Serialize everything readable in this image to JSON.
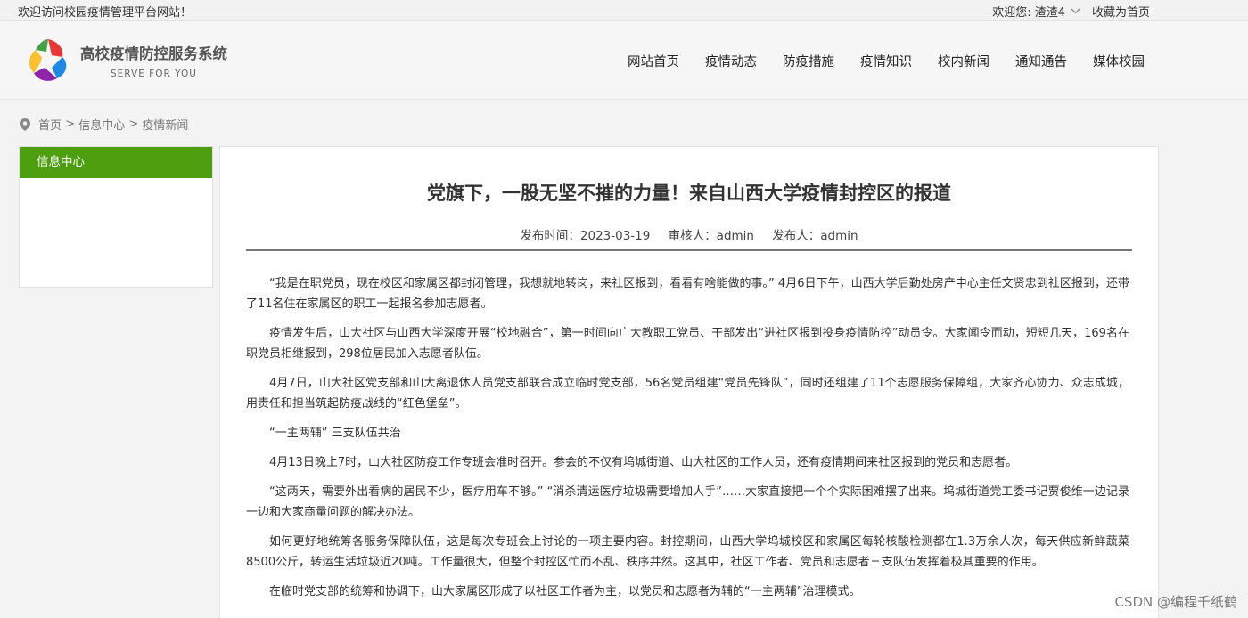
{
  "topbar": {
    "welcome": "欢迎访问校园疫情管理平台网站！",
    "user": "欢迎您: 渣渣4",
    "favorite": "收藏为首页"
  },
  "header": {
    "title": "高校疫情防控服务系统",
    "subtitle": "SERVE FOR YOU",
    "nav": [
      "网站首页",
      "疫情动态",
      "防疫措施",
      "疫情知识",
      "校内新闻",
      "通知通告",
      "媒体校园"
    ]
  },
  "breadcrumb": {
    "home": "首页",
    "sep": " > ",
    "section": "信息中心",
    "page": "疫情新闻"
  },
  "sidebar": {
    "heading": "信息中心"
  },
  "article": {
    "title": "党旗下，一股无坚不摧的力量！来自山西大学疫情封控区的报道",
    "publish_time": "发布时间：2023-03-19",
    "reviewer": "审核人：admin",
    "publisher": "发布人：admin",
    "paragraphs": [
      "“我是在职党员，现在校区和家属区都封闭管理，我想就地转岗，来社区报到，看看有啥能做的事。”  4月6日下午，山西大学后勤处房产中心主任文贤忠到社区报到，还带了11名住在家属区的职工一起报名参加志愿者。",
      "疫情发生后，山大社区与山西大学深度开展“校地融合”，第一时间向广大教职工党员、干部发出“进社区报到投身疫情防控”动员令。大家闻令而动，短短几天，169名在职党员相继报到，298位居民加入志愿者队伍。",
      "4月7日，山大社区党支部和山大离退休人员党支部联合成立临时党支部，56名党员组建“党员先锋队”，同时还组建了11个志愿服务保障组，大家齐心协力、众志成城，用责任和担当筑起防疫战线的“红色堡垒”。",
      "“一主两辅” 三支队伍共治",
      "4月13日晚上7时，山大社区防疫工作专班会准时召开。参会的不仅有坞城街道、山大社区的工作人员，还有疫情期间来社区报到的党员和志愿者。",
      "“这两天，需要外出看病的居民不少，医疗用车不够。”  “消杀清运医疗垃圾需要增加人手”……大家直接把一个个实际困难摆了出来。坞城街道党工委书记贾俊维一边记录一边和大家商量问题的解决办法。",
      "如何更好地统筹各服务保障队伍，这是每次专班会上讨论的一项主要内容。封控期间，山西大学坞城校区和家属区每轮核酸检测都在1.3万余人次，每天供应新鲜蔬菜8500公斤，转运生活垃圾近20吨。工作量很大，但整个封控区忙而不乱、秩序井然。这其中，社区工作者、党员和志愿者三支队伍发挥着极其重要的作用。",
      "在临时党支部的统筹和协调下，山大家属区形成了以社区工作者为主，以党员和志愿者为辅的“一主两辅”治理模式。"
    ]
  },
  "watermark": "CSDN @编程千纸鹤",
  "colors": {
    "accent_green": "#4e9f10",
    "rule": "#777777"
  }
}
